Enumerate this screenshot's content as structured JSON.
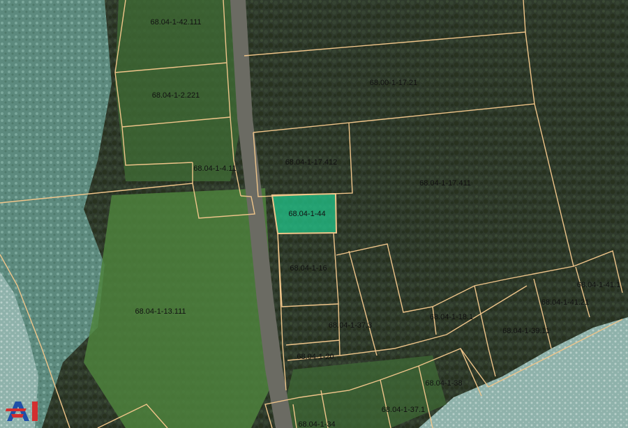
{
  "map": {
    "selected_parcel": "68.04-1-44",
    "colors": {
      "parcel_line": "#f0c58a",
      "selected_fill": "#21c48a",
      "water": "#6f9c93",
      "forest": "#2f3a2c",
      "field": "#4f8a3f",
      "road": "#5a5a55"
    },
    "parcels": [
      {
        "id": "p1",
        "label": "68.04-1-42.111"
      },
      {
        "id": "p2",
        "label": "68.00-1-17.21"
      },
      {
        "id": "p3",
        "label": "68.04-1-2.221"
      },
      {
        "id": "p4",
        "label": "68.04-1-17.412"
      },
      {
        "id": "p5",
        "label": "68.04-1-4.11"
      },
      {
        "id": "p6",
        "label": "68.04-1-17.411"
      },
      {
        "id": "p7",
        "label": "68.04-1-44"
      },
      {
        "id": "p8",
        "label": "68.04-1-16"
      },
      {
        "id": "p9",
        "label": "68.04-1-41.1"
      },
      {
        "id": "p10",
        "label": "68.04-1-41.21"
      },
      {
        "id": "p11",
        "label": "68.04-1-13.111"
      },
      {
        "id": "p12",
        "label": "68.04-1-18.1"
      },
      {
        "id": "p13",
        "label": "68.04-1-37.3"
      },
      {
        "id": "p14",
        "label": "68.04-1-39.11"
      },
      {
        "id": "p15",
        "label": "68.04-1-20"
      },
      {
        "id": "p16",
        "label": "68.04-1-38"
      },
      {
        "id": "p17",
        "label": "68.04-1-37.1"
      },
      {
        "id": "p18",
        "label": "68.04-1-34"
      }
    ]
  },
  "logo": {
    "name": "auction-logo",
    "text": "AI"
  }
}
